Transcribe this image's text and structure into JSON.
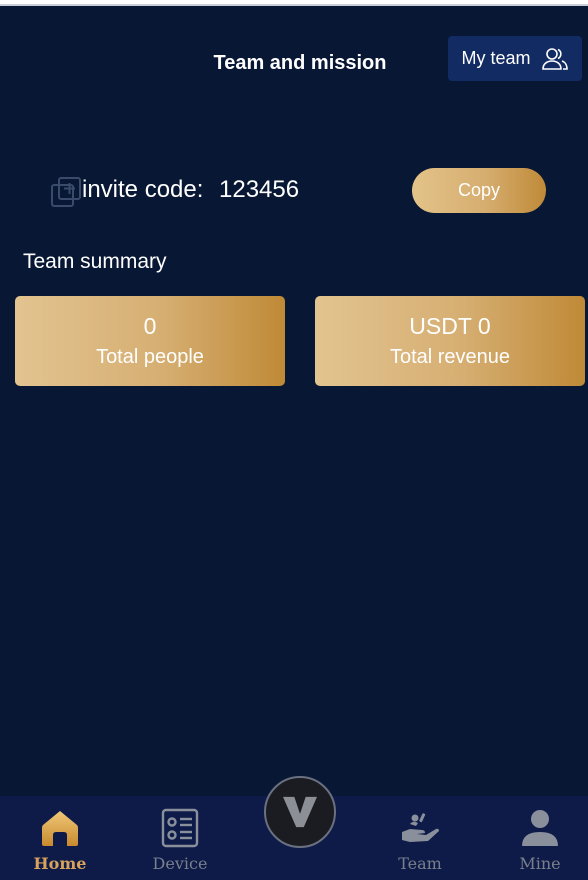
{
  "header": {
    "title": "Team and mission",
    "my_team_label": "My team"
  },
  "invite": {
    "label": "invite code:",
    "code": "123456",
    "copy_label": "Copy"
  },
  "summary": {
    "title": "Team summary",
    "cards": [
      {
        "value": "0",
        "label": "Total people"
      },
      {
        "value": "USDT 0",
        "label": "Total revenue"
      }
    ]
  },
  "tabbar": {
    "items": [
      {
        "label": "Home",
        "icon": "home-icon",
        "active": true
      },
      {
        "label": "Device",
        "icon": "device-icon",
        "active": false
      },
      {
        "label": "",
        "icon": "v-logo-icon",
        "active": false
      },
      {
        "label": "Team",
        "icon": "team-hand-icon",
        "active": false
      },
      {
        "label": "Mine",
        "icon": "user-icon",
        "active": false
      }
    ]
  },
  "colors": {
    "background": "#081733",
    "gold_start": "#e3c389",
    "gold_end": "#bf8a38",
    "tab_active": "#d7a25b",
    "tab_inactive": "#7a7f8c",
    "my_team_bg": "#132b63"
  }
}
